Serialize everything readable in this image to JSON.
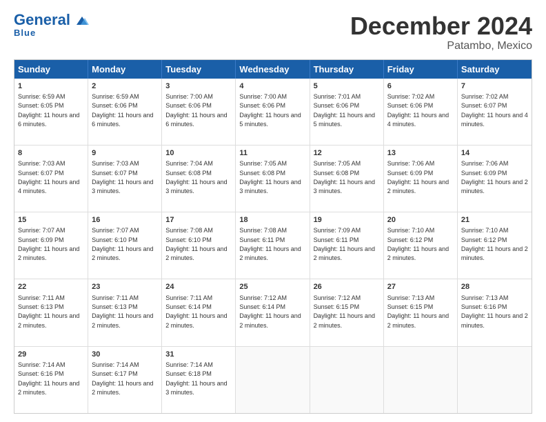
{
  "header": {
    "logo_general": "General",
    "logo_blue": "Blue",
    "title": "December 2024",
    "subtitle": "Patambo, Mexico"
  },
  "days": [
    "Sunday",
    "Monday",
    "Tuesday",
    "Wednesday",
    "Thursday",
    "Friday",
    "Saturday"
  ],
  "weeks": [
    [
      {
        "day": 1,
        "sunrise": "6:59 AM",
        "sunset": "6:05 PM",
        "daylight": "11 hours and 6 minutes."
      },
      {
        "day": 2,
        "sunrise": "6:59 AM",
        "sunset": "6:06 PM",
        "daylight": "11 hours and 6 minutes."
      },
      {
        "day": 3,
        "sunrise": "7:00 AM",
        "sunset": "6:06 PM",
        "daylight": "11 hours and 6 minutes."
      },
      {
        "day": 4,
        "sunrise": "7:00 AM",
        "sunset": "6:06 PM",
        "daylight": "11 hours and 5 minutes."
      },
      {
        "day": 5,
        "sunrise": "7:01 AM",
        "sunset": "6:06 PM",
        "daylight": "11 hours and 5 minutes."
      },
      {
        "day": 6,
        "sunrise": "7:02 AM",
        "sunset": "6:06 PM",
        "daylight": "11 hours and 4 minutes."
      },
      {
        "day": 7,
        "sunrise": "7:02 AM",
        "sunset": "6:07 PM",
        "daylight": "11 hours and 4 minutes."
      }
    ],
    [
      {
        "day": 8,
        "sunrise": "7:03 AM",
        "sunset": "6:07 PM",
        "daylight": "11 hours and 4 minutes."
      },
      {
        "day": 9,
        "sunrise": "7:03 AM",
        "sunset": "6:07 PM",
        "daylight": "11 hours and 3 minutes."
      },
      {
        "day": 10,
        "sunrise": "7:04 AM",
        "sunset": "6:08 PM",
        "daylight": "11 hours and 3 minutes."
      },
      {
        "day": 11,
        "sunrise": "7:05 AM",
        "sunset": "6:08 PM",
        "daylight": "11 hours and 3 minutes."
      },
      {
        "day": 12,
        "sunrise": "7:05 AM",
        "sunset": "6:08 PM",
        "daylight": "11 hours and 3 minutes."
      },
      {
        "day": 13,
        "sunrise": "7:06 AM",
        "sunset": "6:09 PM",
        "daylight": "11 hours and 2 minutes."
      },
      {
        "day": 14,
        "sunrise": "7:06 AM",
        "sunset": "6:09 PM",
        "daylight": "11 hours and 2 minutes."
      }
    ],
    [
      {
        "day": 15,
        "sunrise": "7:07 AM",
        "sunset": "6:09 PM",
        "daylight": "11 hours and 2 minutes."
      },
      {
        "day": 16,
        "sunrise": "7:07 AM",
        "sunset": "6:10 PM",
        "daylight": "11 hours and 2 minutes."
      },
      {
        "day": 17,
        "sunrise": "7:08 AM",
        "sunset": "6:10 PM",
        "daylight": "11 hours and 2 minutes."
      },
      {
        "day": 18,
        "sunrise": "7:08 AM",
        "sunset": "6:11 PM",
        "daylight": "11 hours and 2 minutes."
      },
      {
        "day": 19,
        "sunrise": "7:09 AM",
        "sunset": "6:11 PM",
        "daylight": "11 hours and 2 minutes."
      },
      {
        "day": 20,
        "sunrise": "7:10 AM",
        "sunset": "6:12 PM",
        "daylight": "11 hours and 2 minutes."
      },
      {
        "day": 21,
        "sunrise": "7:10 AM",
        "sunset": "6:12 PM",
        "daylight": "11 hours and 2 minutes."
      }
    ],
    [
      {
        "day": 22,
        "sunrise": "7:11 AM",
        "sunset": "6:13 PM",
        "daylight": "11 hours and 2 minutes."
      },
      {
        "day": 23,
        "sunrise": "7:11 AM",
        "sunset": "6:13 PM",
        "daylight": "11 hours and 2 minutes."
      },
      {
        "day": 24,
        "sunrise": "7:11 AM",
        "sunset": "6:14 PM",
        "daylight": "11 hours and 2 minutes."
      },
      {
        "day": 25,
        "sunrise": "7:12 AM",
        "sunset": "6:14 PM",
        "daylight": "11 hours and 2 minutes."
      },
      {
        "day": 26,
        "sunrise": "7:12 AM",
        "sunset": "6:15 PM",
        "daylight": "11 hours and 2 minutes."
      },
      {
        "day": 27,
        "sunrise": "7:13 AM",
        "sunset": "6:15 PM",
        "daylight": "11 hours and 2 minutes."
      },
      {
        "day": 28,
        "sunrise": "7:13 AM",
        "sunset": "6:16 PM",
        "daylight": "11 hours and 2 minutes."
      }
    ],
    [
      {
        "day": 29,
        "sunrise": "7:14 AM",
        "sunset": "6:16 PM",
        "daylight": "11 hours and 2 minutes."
      },
      {
        "day": 30,
        "sunrise": "7:14 AM",
        "sunset": "6:17 PM",
        "daylight": "11 hours and 2 minutes."
      },
      {
        "day": 31,
        "sunrise": "7:14 AM",
        "sunset": "6:18 PM",
        "daylight": "11 hours and 3 minutes."
      },
      null,
      null,
      null,
      null
    ]
  ]
}
